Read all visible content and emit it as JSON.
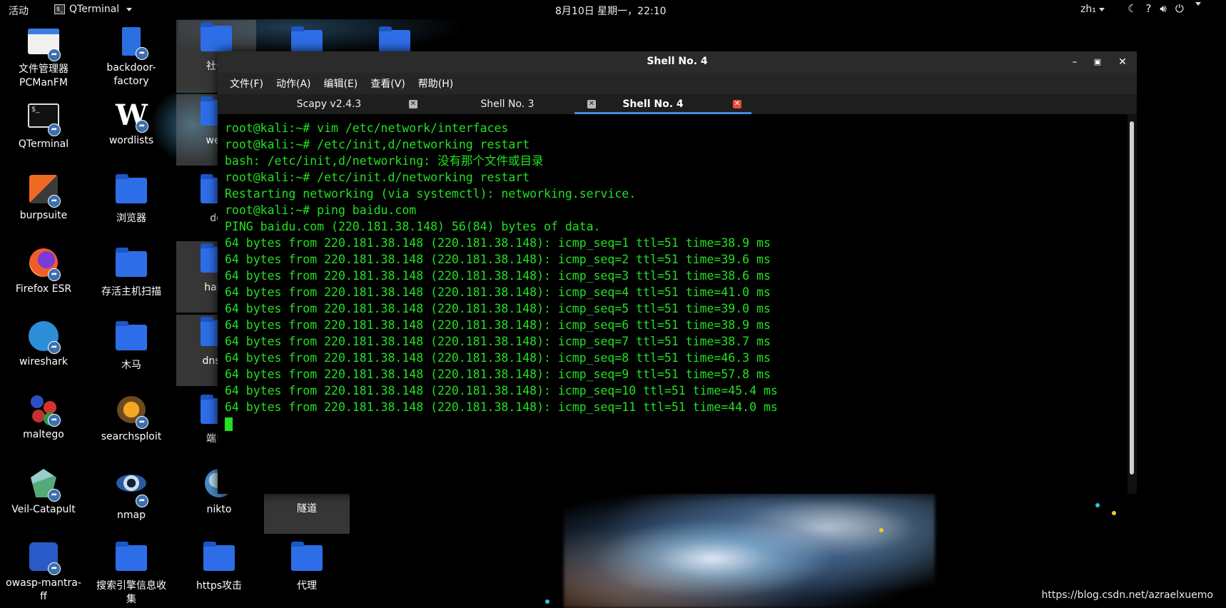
{
  "topbar": {
    "activities": "活动",
    "app_name": "QTerminal",
    "clock": "8月10日 星期一，22:10",
    "lang": "zh₁",
    "tray_icons": [
      "night-light-icon",
      "help-icon",
      "volume-icon",
      "power-icon"
    ]
  },
  "desktop": {
    "icons": [
      {
        "label": "文件管理器\nPCManFM",
        "icon": "file-manager-icon"
      },
      {
        "label": "QTerminal",
        "icon": "terminal-icon"
      },
      {
        "label": "burpsuite",
        "icon": "burpsuite-icon"
      },
      {
        "label": "Firefox ESR",
        "icon": "firefox-icon"
      },
      {
        "label": "wireshark",
        "icon": "wireshark-icon"
      },
      {
        "label": "maltego",
        "icon": "maltego-icon"
      },
      {
        "label": "Veil-Catapult",
        "icon": "veil-icon"
      },
      {
        "label": "owasp-mantra-\nff",
        "icon": "owasp-icon"
      },
      {
        "label": "backdoor-\nfactory",
        "icon": "backdoor-icon"
      },
      {
        "label": "wordlists",
        "icon": "wordlists-icon"
      },
      {
        "label": "浏览器",
        "icon": "folder-icon"
      },
      {
        "label": "存活主机扫描",
        "icon": "folder-icon"
      },
      {
        "label": "木马",
        "icon": "folder-icon"
      },
      {
        "label": "searchsploit",
        "icon": "searchsploit-icon"
      },
      {
        "label": "nmap",
        "icon": "nmap-icon"
      },
      {
        "label": "搜索引擎信息收\n集",
        "icon": "folder-icon"
      },
      {
        "label": "社会",
        "icon": "folder-icon"
      },
      {
        "label": "web",
        "icon": "folder-icon"
      },
      {
        "label": "do",
        "icon": "folder-icon"
      },
      {
        "label": "hash",
        "icon": "folder-icon"
      },
      {
        "label": "dns信",
        "icon": "folder-icon"
      },
      {
        "label": "端口",
        "icon": "folder-icon"
      },
      {
        "label": "nikto",
        "icon": "nikto-icon"
      },
      {
        "label": "https攻击",
        "icon": "folder-icon"
      },
      {
        "label": "隧道",
        "icon": "folder-icon"
      },
      {
        "label": "代理",
        "icon": "folder-icon"
      }
    ]
  },
  "window": {
    "title": "Shell No. 4",
    "menus": [
      "文件(F)",
      "动作(A)",
      "编辑(E)",
      "查看(V)",
      "帮助(H)"
    ],
    "tabs": [
      {
        "label": "Scapy v2.4.3",
        "active": false
      },
      {
        "label": "Shell No. 3",
        "active": false
      },
      {
        "label": "Shell No. 4",
        "active": true
      }
    ],
    "terminal_lines": [
      "root@kali:~# vim /etc/network/interfaces",
      "root@kali:~# /etc/init,d/networking restart",
      "bash: /etc/init,d/networking: 没有那个文件或目录",
      "root@kali:~# /etc/init.d/networking restart",
      "Restarting networking (via systemctl): networking.service.",
      "root@kali:~# ping baidu.com",
      "PING baidu.com (220.181.38.148) 56(84) bytes of data.",
      "64 bytes from 220.181.38.148 (220.181.38.148): icmp_seq=1 ttl=51 time=38.9 ms",
      "64 bytes from 220.181.38.148 (220.181.38.148): icmp_seq=2 ttl=51 time=39.6 ms",
      "64 bytes from 220.181.38.148 (220.181.38.148): icmp_seq=3 ttl=51 time=38.6 ms",
      "64 bytes from 220.181.38.148 (220.181.38.148): icmp_seq=4 ttl=51 time=41.0 ms",
      "64 bytes from 220.181.38.148 (220.181.38.148): icmp_seq=5 ttl=51 time=39.0 ms",
      "64 bytes from 220.181.38.148 (220.181.38.148): icmp_seq=6 ttl=51 time=38.9 ms",
      "64 bytes from 220.181.38.148 (220.181.38.148): icmp_seq=7 ttl=51 time=38.7 ms",
      "64 bytes from 220.181.38.148 (220.181.38.148): icmp_seq=8 ttl=51 time=46.3 ms",
      "64 bytes from 220.181.38.148 (220.181.38.148): icmp_seq=9 ttl=51 time=57.8 ms",
      "64 bytes from 220.181.38.148 (220.181.38.148): icmp_seq=10 ttl=51 time=45.4 ms",
      "64 bytes from 220.181.38.148 (220.181.38.148): icmp_seq=11 ttl=51 time=44.0 ms"
    ],
    "terminal_color": "#21e121"
  },
  "watermark": "https://blog.csdn.net/azraelxuemo"
}
